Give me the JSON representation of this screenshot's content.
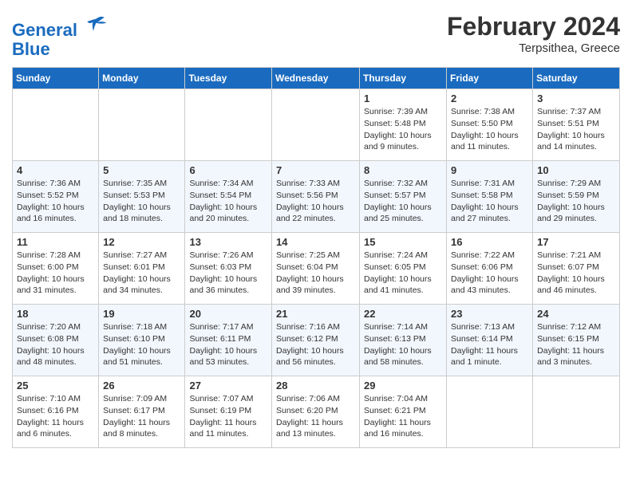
{
  "header": {
    "logo_line1": "General",
    "logo_line2": "Blue",
    "title": "February 2024",
    "subtitle": "Terpsithea, Greece"
  },
  "days_of_week": [
    "Sunday",
    "Monday",
    "Tuesday",
    "Wednesday",
    "Thursday",
    "Friday",
    "Saturday"
  ],
  "weeks": [
    {
      "cells": [
        {
          "day": null,
          "info": ""
        },
        {
          "day": null,
          "info": ""
        },
        {
          "day": null,
          "info": ""
        },
        {
          "day": null,
          "info": ""
        },
        {
          "day": "1",
          "info": "Sunrise: 7:39 AM\nSunset: 5:48 PM\nDaylight: 10 hours\nand 9 minutes."
        },
        {
          "day": "2",
          "info": "Sunrise: 7:38 AM\nSunset: 5:50 PM\nDaylight: 10 hours\nand 11 minutes."
        },
        {
          "day": "3",
          "info": "Sunrise: 7:37 AM\nSunset: 5:51 PM\nDaylight: 10 hours\nand 14 minutes."
        }
      ]
    },
    {
      "cells": [
        {
          "day": "4",
          "info": "Sunrise: 7:36 AM\nSunset: 5:52 PM\nDaylight: 10 hours\nand 16 minutes."
        },
        {
          "day": "5",
          "info": "Sunrise: 7:35 AM\nSunset: 5:53 PM\nDaylight: 10 hours\nand 18 minutes."
        },
        {
          "day": "6",
          "info": "Sunrise: 7:34 AM\nSunset: 5:54 PM\nDaylight: 10 hours\nand 20 minutes."
        },
        {
          "day": "7",
          "info": "Sunrise: 7:33 AM\nSunset: 5:56 PM\nDaylight: 10 hours\nand 22 minutes."
        },
        {
          "day": "8",
          "info": "Sunrise: 7:32 AM\nSunset: 5:57 PM\nDaylight: 10 hours\nand 25 minutes."
        },
        {
          "day": "9",
          "info": "Sunrise: 7:31 AM\nSunset: 5:58 PM\nDaylight: 10 hours\nand 27 minutes."
        },
        {
          "day": "10",
          "info": "Sunrise: 7:29 AM\nSunset: 5:59 PM\nDaylight: 10 hours\nand 29 minutes."
        }
      ]
    },
    {
      "cells": [
        {
          "day": "11",
          "info": "Sunrise: 7:28 AM\nSunset: 6:00 PM\nDaylight: 10 hours\nand 31 minutes."
        },
        {
          "day": "12",
          "info": "Sunrise: 7:27 AM\nSunset: 6:01 PM\nDaylight: 10 hours\nand 34 minutes."
        },
        {
          "day": "13",
          "info": "Sunrise: 7:26 AM\nSunset: 6:03 PM\nDaylight: 10 hours\nand 36 minutes."
        },
        {
          "day": "14",
          "info": "Sunrise: 7:25 AM\nSunset: 6:04 PM\nDaylight: 10 hours\nand 39 minutes."
        },
        {
          "day": "15",
          "info": "Sunrise: 7:24 AM\nSunset: 6:05 PM\nDaylight: 10 hours\nand 41 minutes."
        },
        {
          "day": "16",
          "info": "Sunrise: 7:22 AM\nSunset: 6:06 PM\nDaylight: 10 hours\nand 43 minutes."
        },
        {
          "day": "17",
          "info": "Sunrise: 7:21 AM\nSunset: 6:07 PM\nDaylight: 10 hours\nand 46 minutes."
        }
      ]
    },
    {
      "cells": [
        {
          "day": "18",
          "info": "Sunrise: 7:20 AM\nSunset: 6:08 PM\nDaylight: 10 hours\nand 48 minutes."
        },
        {
          "day": "19",
          "info": "Sunrise: 7:18 AM\nSunset: 6:10 PM\nDaylight: 10 hours\nand 51 minutes."
        },
        {
          "day": "20",
          "info": "Sunrise: 7:17 AM\nSunset: 6:11 PM\nDaylight: 10 hours\nand 53 minutes."
        },
        {
          "day": "21",
          "info": "Sunrise: 7:16 AM\nSunset: 6:12 PM\nDaylight: 10 hours\nand 56 minutes."
        },
        {
          "day": "22",
          "info": "Sunrise: 7:14 AM\nSunset: 6:13 PM\nDaylight: 10 hours\nand 58 minutes."
        },
        {
          "day": "23",
          "info": "Sunrise: 7:13 AM\nSunset: 6:14 PM\nDaylight: 11 hours\nand 1 minute."
        },
        {
          "day": "24",
          "info": "Sunrise: 7:12 AM\nSunset: 6:15 PM\nDaylight: 11 hours\nand 3 minutes."
        }
      ]
    },
    {
      "cells": [
        {
          "day": "25",
          "info": "Sunrise: 7:10 AM\nSunset: 6:16 PM\nDaylight: 11 hours\nand 6 minutes."
        },
        {
          "day": "26",
          "info": "Sunrise: 7:09 AM\nSunset: 6:17 PM\nDaylight: 11 hours\nand 8 minutes."
        },
        {
          "day": "27",
          "info": "Sunrise: 7:07 AM\nSunset: 6:19 PM\nDaylight: 11 hours\nand 11 minutes."
        },
        {
          "day": "28",
          "info": "Sunrise: 7:06 AM\nSunset: 6:20 PM\nDaylight: 11 hours\nand 13 minutes."
        },
        {
          "day": "29",
          "info": "Sunrise: 7:04 AM\nSunset: 6:21 PM\nDaylight: 11 hours\nand 16 minutes."
        },
        {
          "day": null,
          "info": ""
        },
        {
          "day": null,
          "info": ""
        }
      ]
    }
  ]
}
